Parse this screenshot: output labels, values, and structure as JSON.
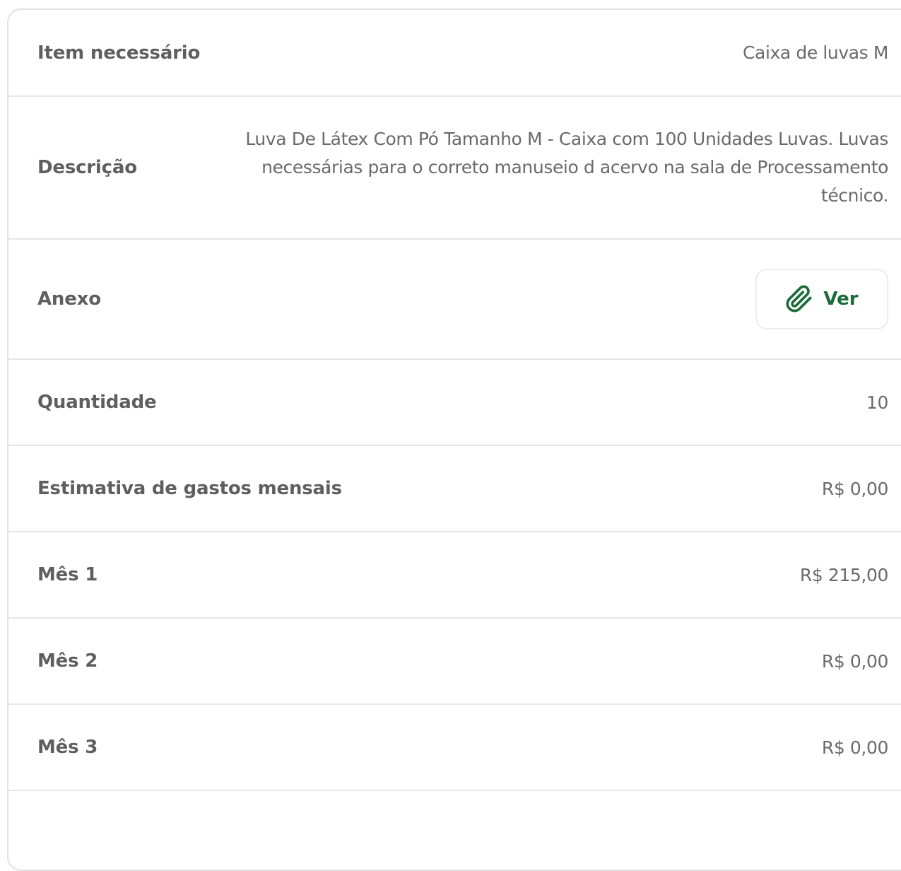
{
  "details": {
    "item": {
      "label": "Item necessário",
      "value": "Caixa de luvas M"
    },
    "description": {
      "label": "Descrição",
      "lines": [
        "Luva De Látex Com Pó Tamanho M - Caixa com 100 Unidades Luvas. Luvas",
        "necessárias para o correto manuseio d acervo na sala de Processamento",
        "técnico."
      ]
    },
    "attachment": {
      "label": "Anexo",
      "button_label": "Ver",
      "icon": "paperclip-icon"
    },
    "quantity": {
      "label": "Quantidade",
      "value": "10"
    },
    "monthly_estimate": {
      "label": "Estimativa de gastos mensais",
      "value": "R$ 0,00"
    },
    "month1": {
      "label": "Mês 1",
      "value": "R$ 215,00"
    },
    "month2": {
      "label": "Mês 2",
      "value": "R$ 0,00"
    },
    "month3": {
      "label": "Mês 3",
      "value": "R$ 0,00"
    }
  },
  "colors": {
    "accent": "#1c6b3a",
    "label_text": "#5f5f5f",
    "value_text": "#6a6a6a",
    "divider": "#e6e6e6"
  }
}
